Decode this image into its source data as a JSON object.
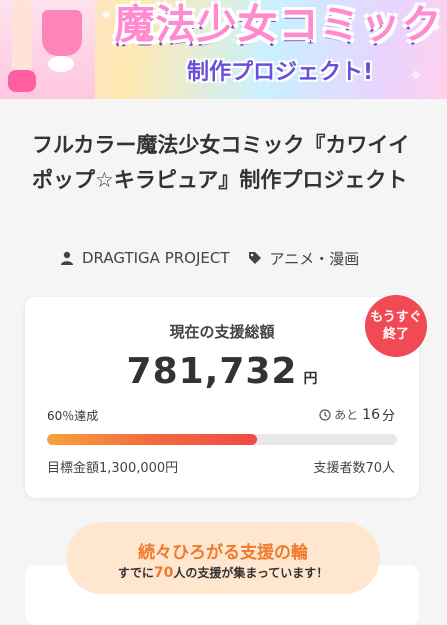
{
  "banner": {
    "title": "魔法少女コミック",
    "subtitle": "制作プロジェクト!"
  },
  "project": {
    "title": "フルカラー魔法少女コミック『カワイイポップ☆キラピュア』制作プロジェクト",
    "owner": "DRAGTIGA PROJECT",
    "category": "アニメ・漫画",
    "owner_icon": "person-icon",
    "category_icon": "tag-icon"
  },
  "funding": {
    "label": "現在の支援総額",
    "amount": "781,732",
    "currency": "円",
    "badge_line1": "もうすぐ",
    "badge_line2": "終了",
    "percent": "60",
    "percent_suffix": "％達成",
    "progress_fraction": 0.6,
    "remaining_prefix": "あと",
    "remaining_value": "16",
    "remaining_unit": "分",
    "goal": "目標金額1,300,000円",
    "backers": "支援者数70人",
    "accent_color": "#f04a54"
  },
  "support_ring": {
    "title": "続々ひろがる支援の輪",
    "sub_before": "すでに",
    "count": "70",
    "sub_after": "人の支援が集まっています！"
  }
}
